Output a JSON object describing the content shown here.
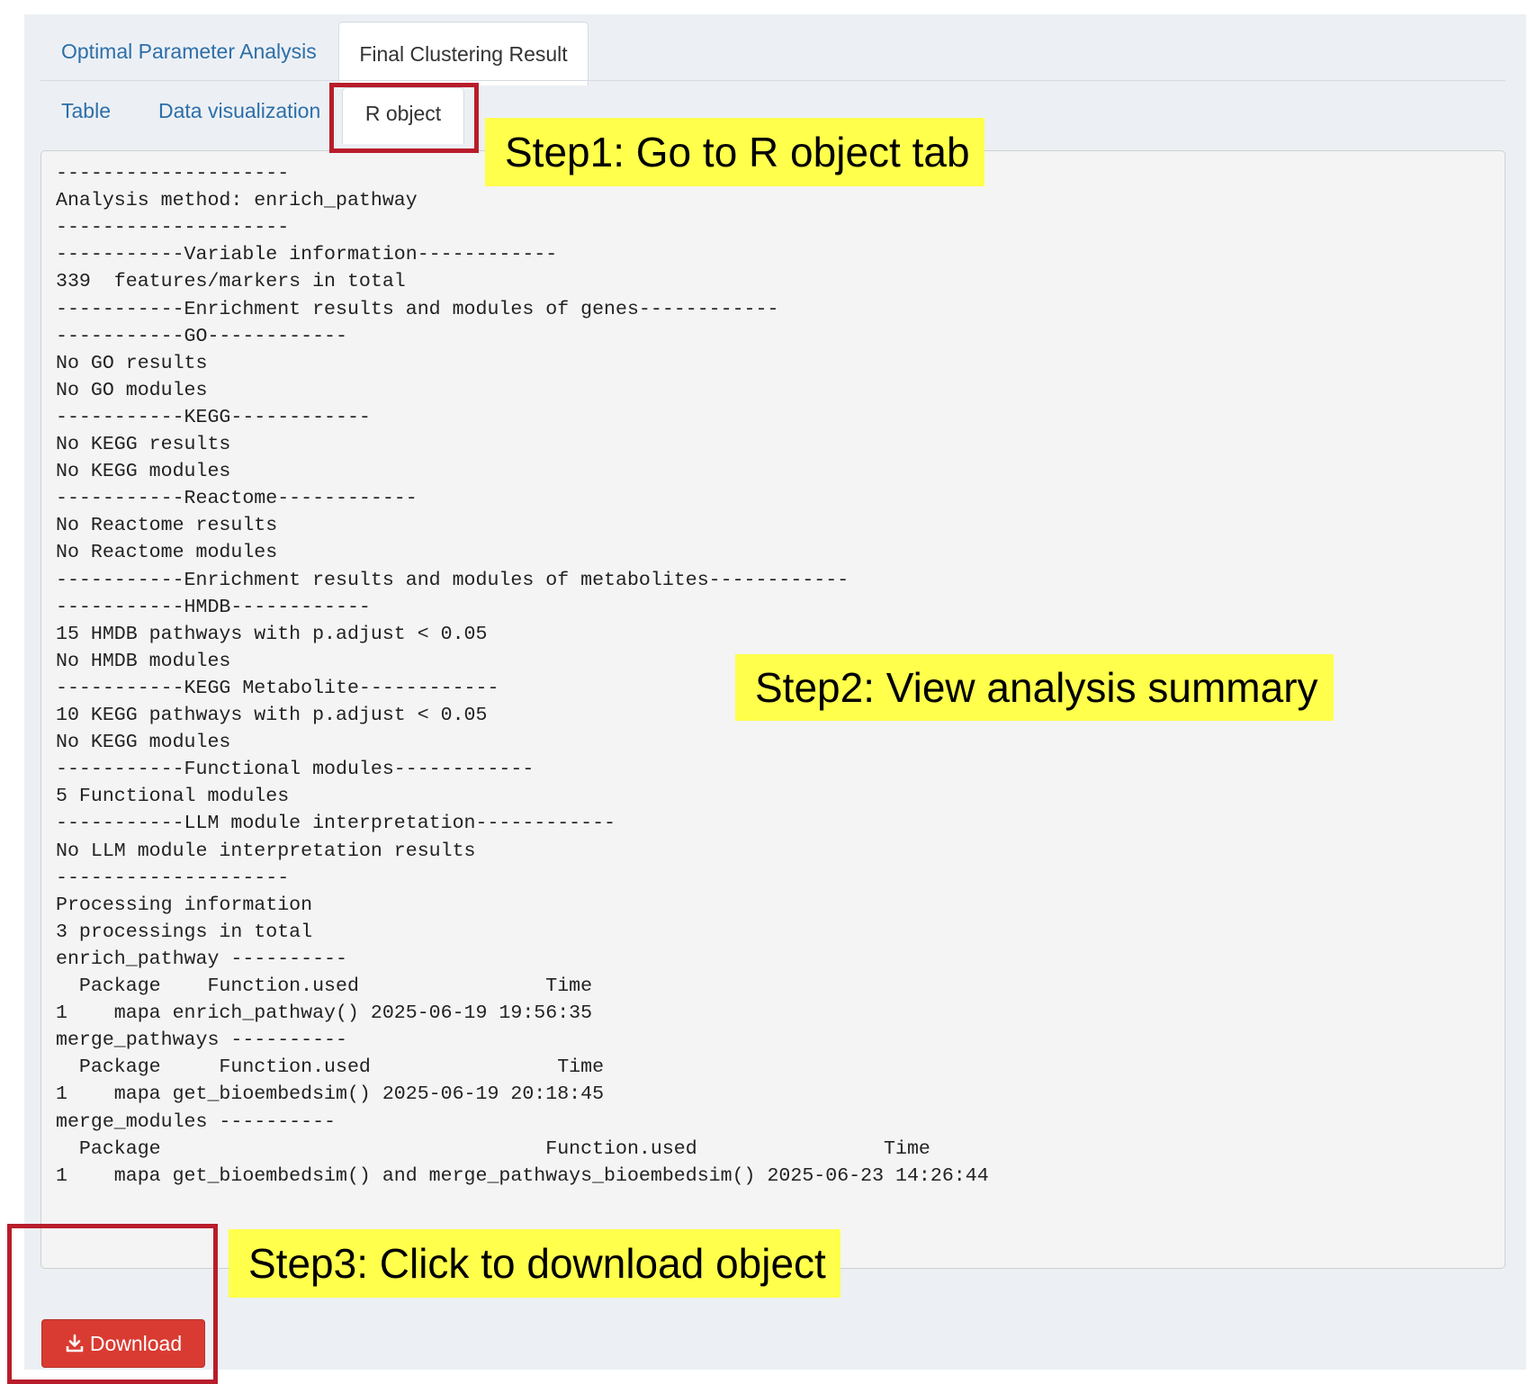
{
  "main_tabs": [
    {
      "label": "Optimal Parameter Analysis",
      "active": false
    },
    {
      "label": "Final Clustering Result",
      "active": true
    }
  ],
  "sub_tabs": [
    {
      "label": "Table",
      "active": false
    },
    {
      "label": "Data visualization",
      "active": false
    },
    {
      "label": "R object",
      "active": true
    }
  ],
  "output_lines": [
    "--------------------",
    "Analysis method: enrich_pathway",
    "--------------------",
    "-----------Variable information------------",
    "339  features/markers in total",
    "-----------Enrichment results and modules of genes------------",
    "-----------GO------------",
    "No GO results",
    "No GO modules",
    "-----------KEGG------------",
    "No KEGG results",
    "No KEGG modules",
    "-----------Reactome------------",
    "No Reactome results",
    "No Reactome modules",
    "-----------Enrichment results and modules of metabolites------------",
    "-----------HMDB------------",
    "15 HMDB pathways with p.adjust < 0.05",
    "No HMDB modules",
    "-----------KEGG Metabolite------------",
    "10 KEGG pathways with p.adjust < 0.05",
    "No KEGG modules",
    "-----------Functional modules------------",
    "5 Functional modules",
    "-----------LLM module interpretation------------",
    "No LLM module interpretation results",
    "--------------------",
    "Processing information",
    "3 processings in total",
    "enrich_pathway ----------",
    "  Package    Function.used                Time",
    "1    mapa enrich_pathway() 2025-06-19 19:56:35",
    "merge_pathways ----------",
    "  Package     Function.used                Time",
    "1    mapa get_bioembedsim() 2025-06-19 20:18:45",
    "merge_modules ----------",
    "  Package                                 Function.used                Time",
    "1    mapa get_bioembedsim() and merge_pathways_bioembedsim() 2025-06-23 14:26:44"
  ],
  "download_button": {
    "label": "Download",
    "icon": "download-icon"
  },
  "annotations": {
    "step1": "Step1: Go to R object tab",
    "step2": "Step2: View analysis summary",
    "step3": "Step3: Click to download object"
  },
  "colors": {
    "tab_link": "#2d6fa8",
    "highlight": "#ffff4c",
    "annotation_box": "#b81d2b",
    "download_button": "#d93b32",
    "panel_bg": "#ecf0f5"
  }
}
